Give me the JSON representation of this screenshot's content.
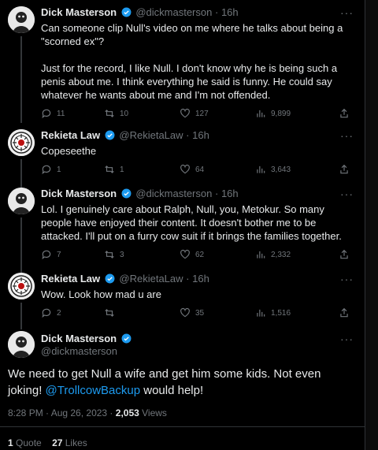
{
  "tweets": [
    {
      "name": "Dick Masterson",
      "handle": "@dickmasterson",
      "dot": "·",
      "time": "16h",
      "text": "Can someone clip Null's video on me where he talks about being a \"scorned ex\"?\n\nJust for the record, I like Null. I don't know why he is being such a penis about me. I think everything he said is funny. He could say whatever he wants about me and I'm not offended.",
      "replies": "11",
      "retweets": "10",
      "likes": "127",
      "views": "9,899"
    },
    {
      "name": "Rekieta Law",
      "handle": "@RekietaLaw",
      "dot": "·",
      "time": "16h",
      "text": "Copeseethe",
      "replies": "1",
      "retweets": "1",
      "likes": "64",
      "views": "3,643"
    },
    {
      "name": "Dick Masterson",
      "handle": "@dickmasterson",
      "dot": "·",
      "time": "16h",
      "text": "Lol. I genuinely care about Ralph, Null, you, Metokur. So many people have enjoyed their content. It doesn't bother me to be attacked. I'll put on a furry cow suit if it brings the families together.",
      "replies": "7",
      "retweets": "3",
      "likes": "62",
      "views": "2,332"
    },
    {
      "name": "Rekieta Law",
      "handle": "@RekietaLaw",
      "dot": "·",
      "time": "16h",
      "text": "Wow. Look how mad u are",
      "replies": "2",
      "retweets": "",
      "likes": "35",
      "views": "1,516"
    }
  ],
  "main": {
    "name": "Dick Masterson",
    "handle": "@dickmasterson",
    "text_a": "We need to get Null a wife and get him some kids. Not even joking!",
    "mention": "@TrollcowBackup",
    "text_b": " would help!",
    "time": "8:28 PM · Aug 26, 2023 · ",
    "views_count": "2,053",
    "views_label": " Views",
    "quotes_count": "1",
    "quotes_label": " Quote",
    "likes_count": "27",
    "likes_label": " Likes"
  },
  "more_glyph": "···",
  "colors": {
    "accent": "#1d9bf0",
    "muted": "#71767b",
    "text": "#e7e9ea"
  }
}
